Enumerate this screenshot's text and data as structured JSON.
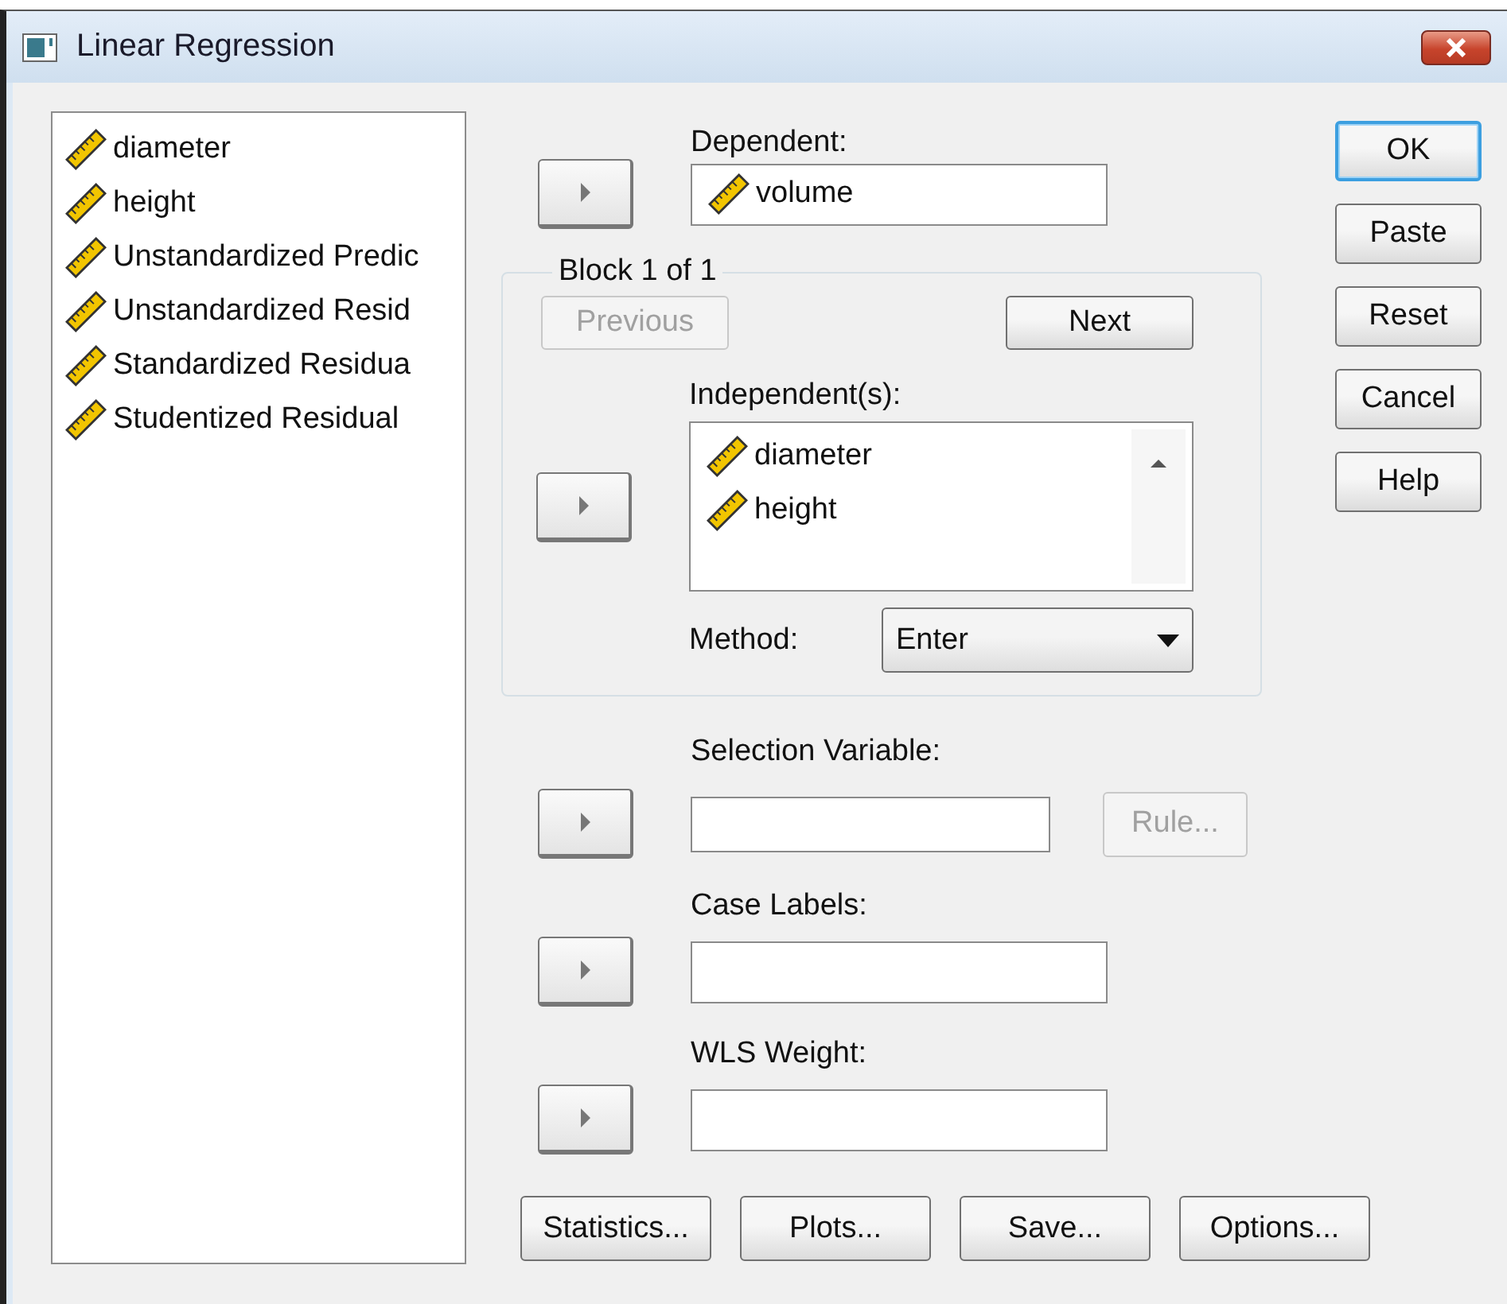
{
  "window": {
    "title": "Linear Regression"
  },
  "variables": [
    {
      "name": "diameter"
    },
    {
      "name": "height"
    },
    {
      "name": "Unstandardized Predic"
    },
    {
      "name": "Unstandardized Resid"
    },
    {
      "name": "Standardized Residua"
    },
    {
      "name": "Studentized Residual"
    }
  ],
  "dependent": {
    "label": "Dependent:",
    "value": "volume"
  },
  "block": {
    "title": "Block 1 of 1",
    "buttons": [
      {
        "label": "Previous",
        "disabled": true
      },
      {
        "label": "Next",
        "disabled": false
      }
    ],
    "independent": {
      "label": "Independent(s):",
      "items": [
        "diameter",
        "height"
      ]
    },
    "method": {
      "label": "Method:",
      "value": "Enter"
    }
  },
  "selection_variable": {
    "label": "Selection Variable:",
    "rule_button": {
      "label": "Rule...",
      "disabled": true
    }
  },
  "case_labels": {
    "label": "Case Labels:"
  },
  "wls_weight": {
    "label": "WLS Weight:"
  },
  "side_buttons": [
    {
      "label": "OK",
      "default": true
    },
    {
      "label": "Paste",
      "default": false
    },
    {
      "label": "Reset",
      "default": false
    },
    {
      "label": "Cancel",
      "default": false
    },
    {
      "label": "Help",
      "default": false
    }
  ],
  "bottom_buttons": [
    "Statistics...",
    "Plots...",
    "Save...",
    "Options..."
  ]
}
